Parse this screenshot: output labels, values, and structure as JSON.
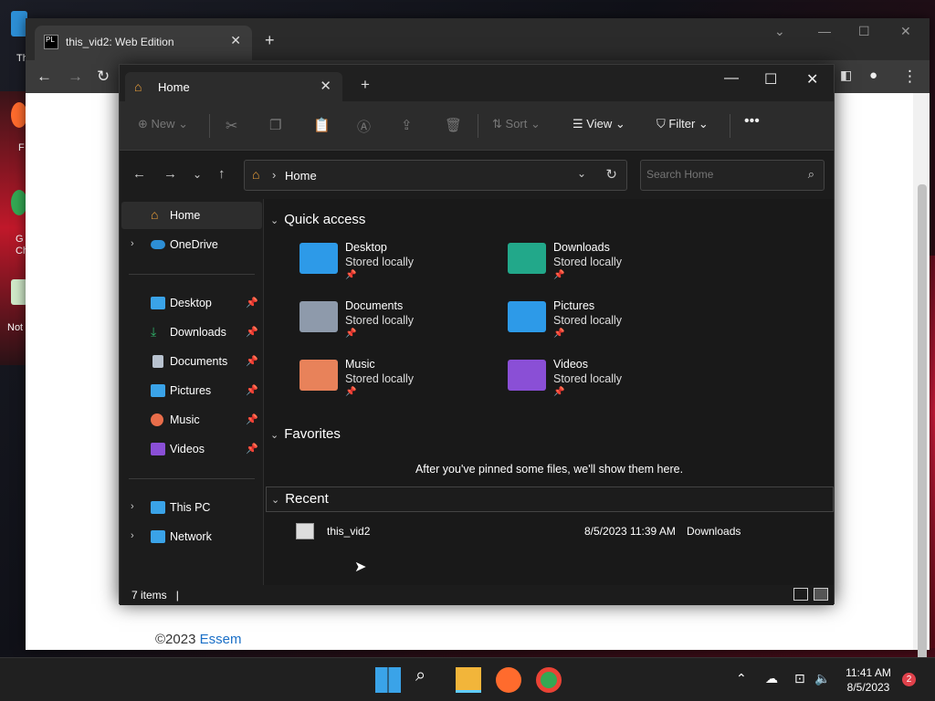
{
  "desktop": {
    "icons": [
      {
        "label": "Th",
        "color": "#2d8fd6"
      },
      {
        "label": "F",
        "color": "#ff6b2d"
      },
      {
        "label": "G\nCh",
        "color": "#34a853"
      },
      {
        "label": "Not",
        "color": "#cfe8c8"
      }
    ]
  },
  "browser": {
    "tab_title": "this_vid2: Web Edition",
    "tab_favicon": "PL",
    "copyright": "©2023",
    "copyright_link": "Essem"
  },
  "explorer": {
    "tab_title": "Home",
    "commands": {
      "new": "New",
      "sort": "Sort",
      "view": "View",
      "filter": "Filter"
    },
    "address": "Home",
    "search_placeholder": "Search Home",
    "sidebar": {
      "top": [
        {
          "label": "Home",
          "selected": true,
          "expandable": false,
          "icon": "home-icon",
          "color": "#f2a33a"
        },
        {
          "label": "OneDrive",
          "selected": false,
          "expandable": true,
          "icon": "cloud-icon",
          "color": "#2d8fd6"
        }
      ],
      "pinned": [
        {
          "label": "Desktop",
          "icon": "desktop-icon",
          "color": "#3aa3e8"
        },
        {
          "label": "Downloads",
          "icon": "download-icon",
          "color": "#2fb46a"
        },
        {
          "label": "Documents",
          "icon": "document-icon",
          "color": "#b8c2cf"
        },
        {
          "label": "Pictures",
          "icon": "picture-icon",
          "color": "#3aa3e8"
        },
        {
          "label": "Music",
          "icon": "music-icon",
          "color": "#e86d4a"
        },
        {
          "label": "Videos",
          "icon": "video-icon",
          "color": "#8a4fd6"
        }
      ],
      "bottom": [
        {
          "label": "This PC",
          "icon": "pc-icon",
          "color": "#3aa3e8"
        },
        {
          "label": "Network",
          "icon": "network-icon",
          "color": "#3aa3e8"
        }
      ]
    },
    "sections": {
      "quick_access": "Quick access",
      "favorites": "Favorites",
      "recent": "Recent"
    },
    "quick_access": [
      {
        "name": "Desktop",
        "sub": "Stored locally",
        "color": "#2d9ae8",
        "icon": "desktop-folder-icon"
      },
      {
        "name": "Downloads",
        "sub": "Stored locally",
        "color": "#22a88a",
        "icon": "downloads-folder-icon"
      },
      {
        "name": "Documents",
        "sub": "Stored locally",
        "color": "#8e9aab",
        "icon": "documents-folder-icon"
      },
      {
        "name": "Pictures",
        "sub": "Stored locally",
        "color": "#2d9ae8",
        "icon": "pictures-folder-icon"
      },
      {
        "name": "Music",
        "sub": "Stored locally",
        "color": "#e8825a",
        "icon": "music-folder-icon"
      },
      {
        "name": "Videos",
        "sub": "Stored locally",
        "color": "#8a4fd6",
        "icon": "videos-folder-icon"
      }
    ],
    "favorites_empty": "After you've pinned some files, we'll show them here.",
    "recent": [
      {
        "name": "this_vid2",
        "date": "8/5/2023 11:39 AM",
        "location": "Downloads"
      }
    ],
    "status": "7 items"
  },
  "taskbar": {
    "time": "11:41 AM",
    "date": "8/5/2023",
    "notifications": "2"
  }
}
